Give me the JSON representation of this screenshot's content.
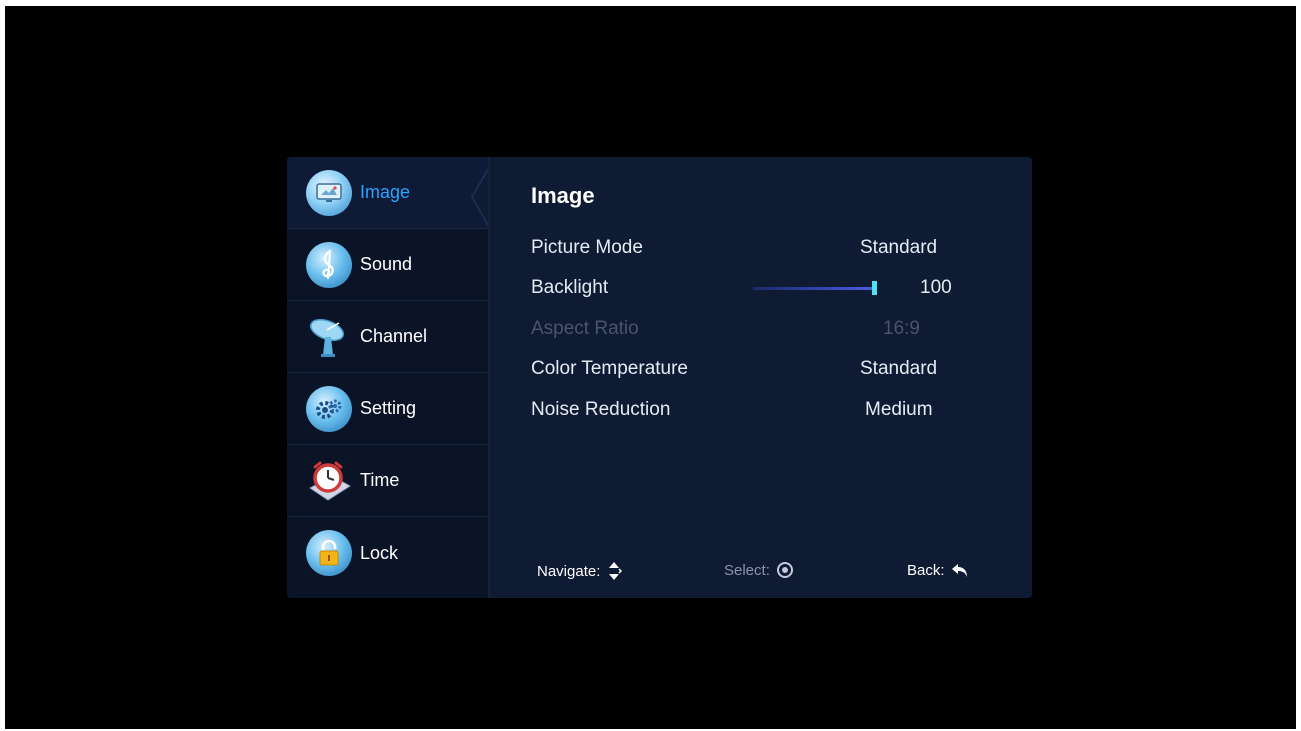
{
  "sidebar": {
    "items": [
      {
        "label": "Image",
        "icon": "image-icon",
        "active": true
      },
      {
        "label": "Sound",
        "icon": "sound-icon"
      },
      {
        "label": "Channel",
        "icon": "channel-icon"
      },
      {
        "label": "Setting",
        "icon": "setting-icon"
      },
      {
        "label": "Time",
        "icon": "time-icon"
      },
      {
        "label": "Lock",
        "icon": "lock-icon"
      }
    ]
  },
  "main": {
    "title": "Image",
    "rows": [
      {
        "name": "Picture Mode",
        "value": "Standard"
      },
      {
        "name": "Backlight",
        "value": "100",
        "slider_level": 1.0
      },
      {
        "name": "Aspect Ratio",
        "value": "16:9",
        "disabled": true
      },
      {
        "name": "Color Temperature",
        "value": "Standard"
      },
      {
        "name": "Noise Reduction",
        "value": "Medium"
      }
    ]
  },
  "footer": {
    "navigate_label": "Navigate:",
    "select_label": "Select:",
    "back_label": "Back:"
  },
  "colors": {
    "accent": "#29a3ff",
    "panel": "#0f1a33",
    "sidebar": "#0b1427",
    "slider_thumb": "#4fe3f2"
  }
}
